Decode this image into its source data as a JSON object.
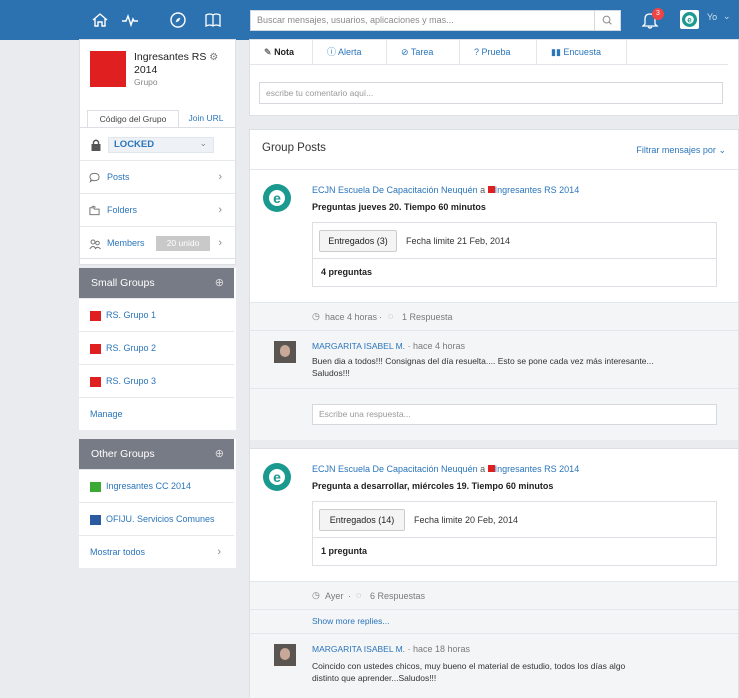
{
  "topbar": {
    "search_placeholder": "Buscar mensajes, usuarios, aplicaciones y mas...",
    "notification_count": "3",
    "user_label": "Yo"
  },
  "group": {
    "name_line1": "Ingresantes RS",
    "name_line2": "2014",
    "type": "Grupo",
    "tab_code": "Código del Grupo",
    "tab_join": "Join URL",
    "locked_label": "LOCKED"
  },
  "sidebar": {
    "posts": "Posts",
    "folders": "Folders",
    "members": "Members",
    "members_badge": "20 unido"
  },
  "small_groups": {
    "title": "Small Groups",
    "items": [
      {
        "label": "RS. Grupo 1",
        "color": "#e02020"
      },
      {
        "label": "RS. Grupo 2",
        "color": "#e02020"
      },
      {
        "label": "RS. Grupo 3",
        "color": "#e02020"
      }
    ],
    "manage": "Manage"
  },
  "other_groups": {
    "title": "Other Groups",
    "items": [
      {
        "label": "Ingresantes CC 2014",
        "color": "#3aaa35"
      },
      {
        "label": "OFIJU. Servicios Comunes",
        "color": "#2a5aa0"
      }
    ],
    "show_all": "Mostrar todos"
  },
  "composer": {
    "tabs": [
      "Nota",
      "Alerta",
      "Tarea",
      "Prueba",
      "Encuesta"
    ],
    "placeholder": "escribe tu comentario aquí..."
  },
  "feed": {
    "title": "Group Posts",
    "filter": "Filtrar mensajes por",
    "posts": [
      {
        "author": "ECJN Escuela De Capacitación Neuquén",
        "connector": "a",
        "group": "Ingresantes RS 2014",
        "title": "Preguntas jueves 20. Tiempo 60 minutos",
        "delivered": "Entregados (3)",
        "deadline": "Fecha limite 21 Feb, 2014",
        "count": "4 preguntas",
        "time": "hace 4 horas",
        "replies": "1 Respuesta",
        "reply": {
          "author": "MARGARITA ISABEL M.",
          "time": "hace 4 horas",
          "text1": "Buen dia a todos!!! Consignas del día resuelta.... Esto se pone cada vez más interesante...",
          "text2": "Saludos!!!"
        },
        "reply_placeholder": "Escribe una respuesta..."
      },
      {
        "author": "ECJN Escuela De Capacitación Neuquén",
        "connector": "a",
        "group": "Ingresantes RS 2014",
        "title": "Pregunta a desarrollar, miércoles 19. Tiempo 60 minutos",
        "delivered": "Entregados (14)",
        "deadline": "Fecha limite 20 Feb, 2014",
        "count": "1 pregunta",
        "time": "Ayer",
        "replies": "6 Respuestas",
        "show_more": "Show more replies...",
        "reply": {
          "author": "MARGARITA ISABEL M.",
          "time": "hace 18 horas",
          "text1": "Coincido con ustedes chicos, muy bueno el material de estudio, todos los días algo",
          "text2": "distinto que aprender...Saludos!!!"
        }
      }
    ]
  },
  "colors": {
    "brand": "#2c72b0",
    "group_red": "#e02020",
    "link": "#2a75bb"
  }
}
